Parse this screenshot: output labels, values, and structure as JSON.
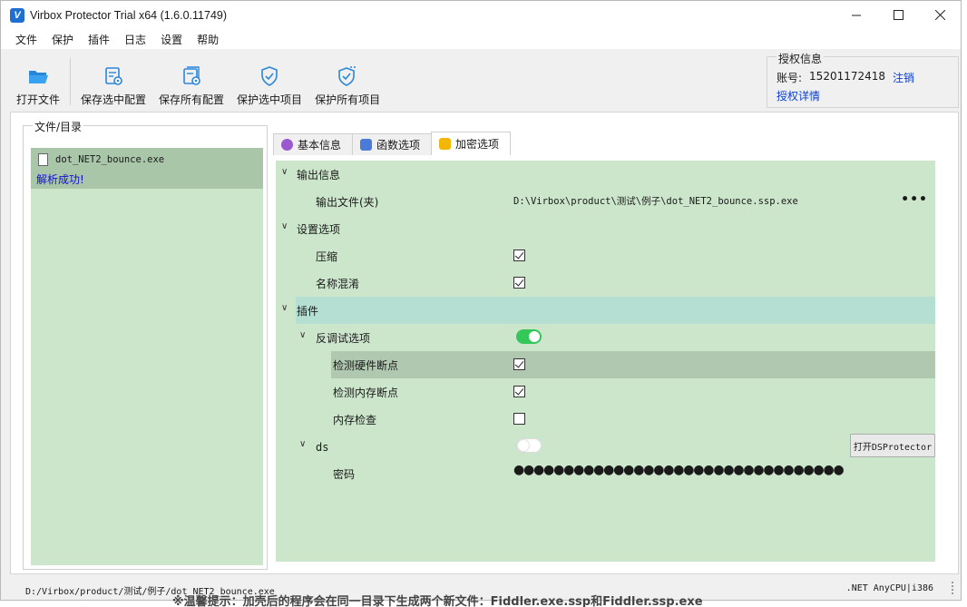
{
  "window": {
    "app_logo": "V",
    "title": "Virbox Protector Trial x64  (1.6.0.11749)",
    "controls": [
      "minimize",
      "maximize",
      "close"
    ]
  },
  "menu": [
    "文件",
    "保护",
    "插件",
    "日志",
    "设置",
    "帮助"
  ],
  "toolbar": {
    "open_file": "打开文件",
    "save_selected": "保存选中配置",
    "save_all": "保存所有配置",
    "protect_selected": "保护选中项目",
    "protect_all": "保护所有项目"
  },
  "license": {
    "title": "授权信息",
    "account_label": "账号:",
    "account": "15201172418",
    "logout": "注销",
    "details": "授权详情"
  },
  "files": {
    "title": "文件/目录",
    "name": "dot_NET2_bounce.exe",
    "status": "解析成功!"
  },
  "tabs": [
    {
      "label": "基本信息",
      "icon": "info-bubble-icon",
      "color": "#9b59d0"
    },
    {
      "label": "函数选项",
      "icon": "function-icon",
      "color": "#4a7bd6"
    },
    {
      "label": "加密选项",
      "icon": "lock-icon",
      "color": "#f2b705",
      "active": true
    }
  ],
  "props": {
    "output_section": "输出信息",
    "output_file_label": "输出文件(夹)",
    "output_file_value": "D:\\Virbox\\product\\测试\\例子\\dot_NET2_bounce.ssp.exe",
    "more": "•••",
    "settings_section": "设置选项",
    "compress_label": "压缩",
    "compress_checked": true,
    "obfuscate_label": "名称混淆",
    "obfuscate_checked": true,
    "plugin_section": "插件",
    "antidebug_label": "反调试选项",
    "antidebug_on": true,
    "hw_bp_label": "检测硬件断点",
    "hw_bp_checked": true,
    "mem_bp_label": "检测内存断点",
    "mem_bp_checked": true,
    "mem_check_label": "内存检查",
    "mem_check_checked": false,
    "ds_label": "ds",
    "ds_on": false,
    "ds_button": "打开DSProtector",
    "password_label": "密码",
    "password_mask": "●●●●●●●●●●●●●●●●●●●●●●●●●●●●●●●●●"
  },
  "status": {
    "path": "D:/Virbox/product/测试/例子/dot_NET2_bounce.exe",
    "platform": ".NET AnyCPU|i386"
  },
  "background_text": "※温馨提示：加壳后的程序会在同一目录下生成两个新文件：Fiddler.exe.ssp和Fiddler.ssp.exe"
}
